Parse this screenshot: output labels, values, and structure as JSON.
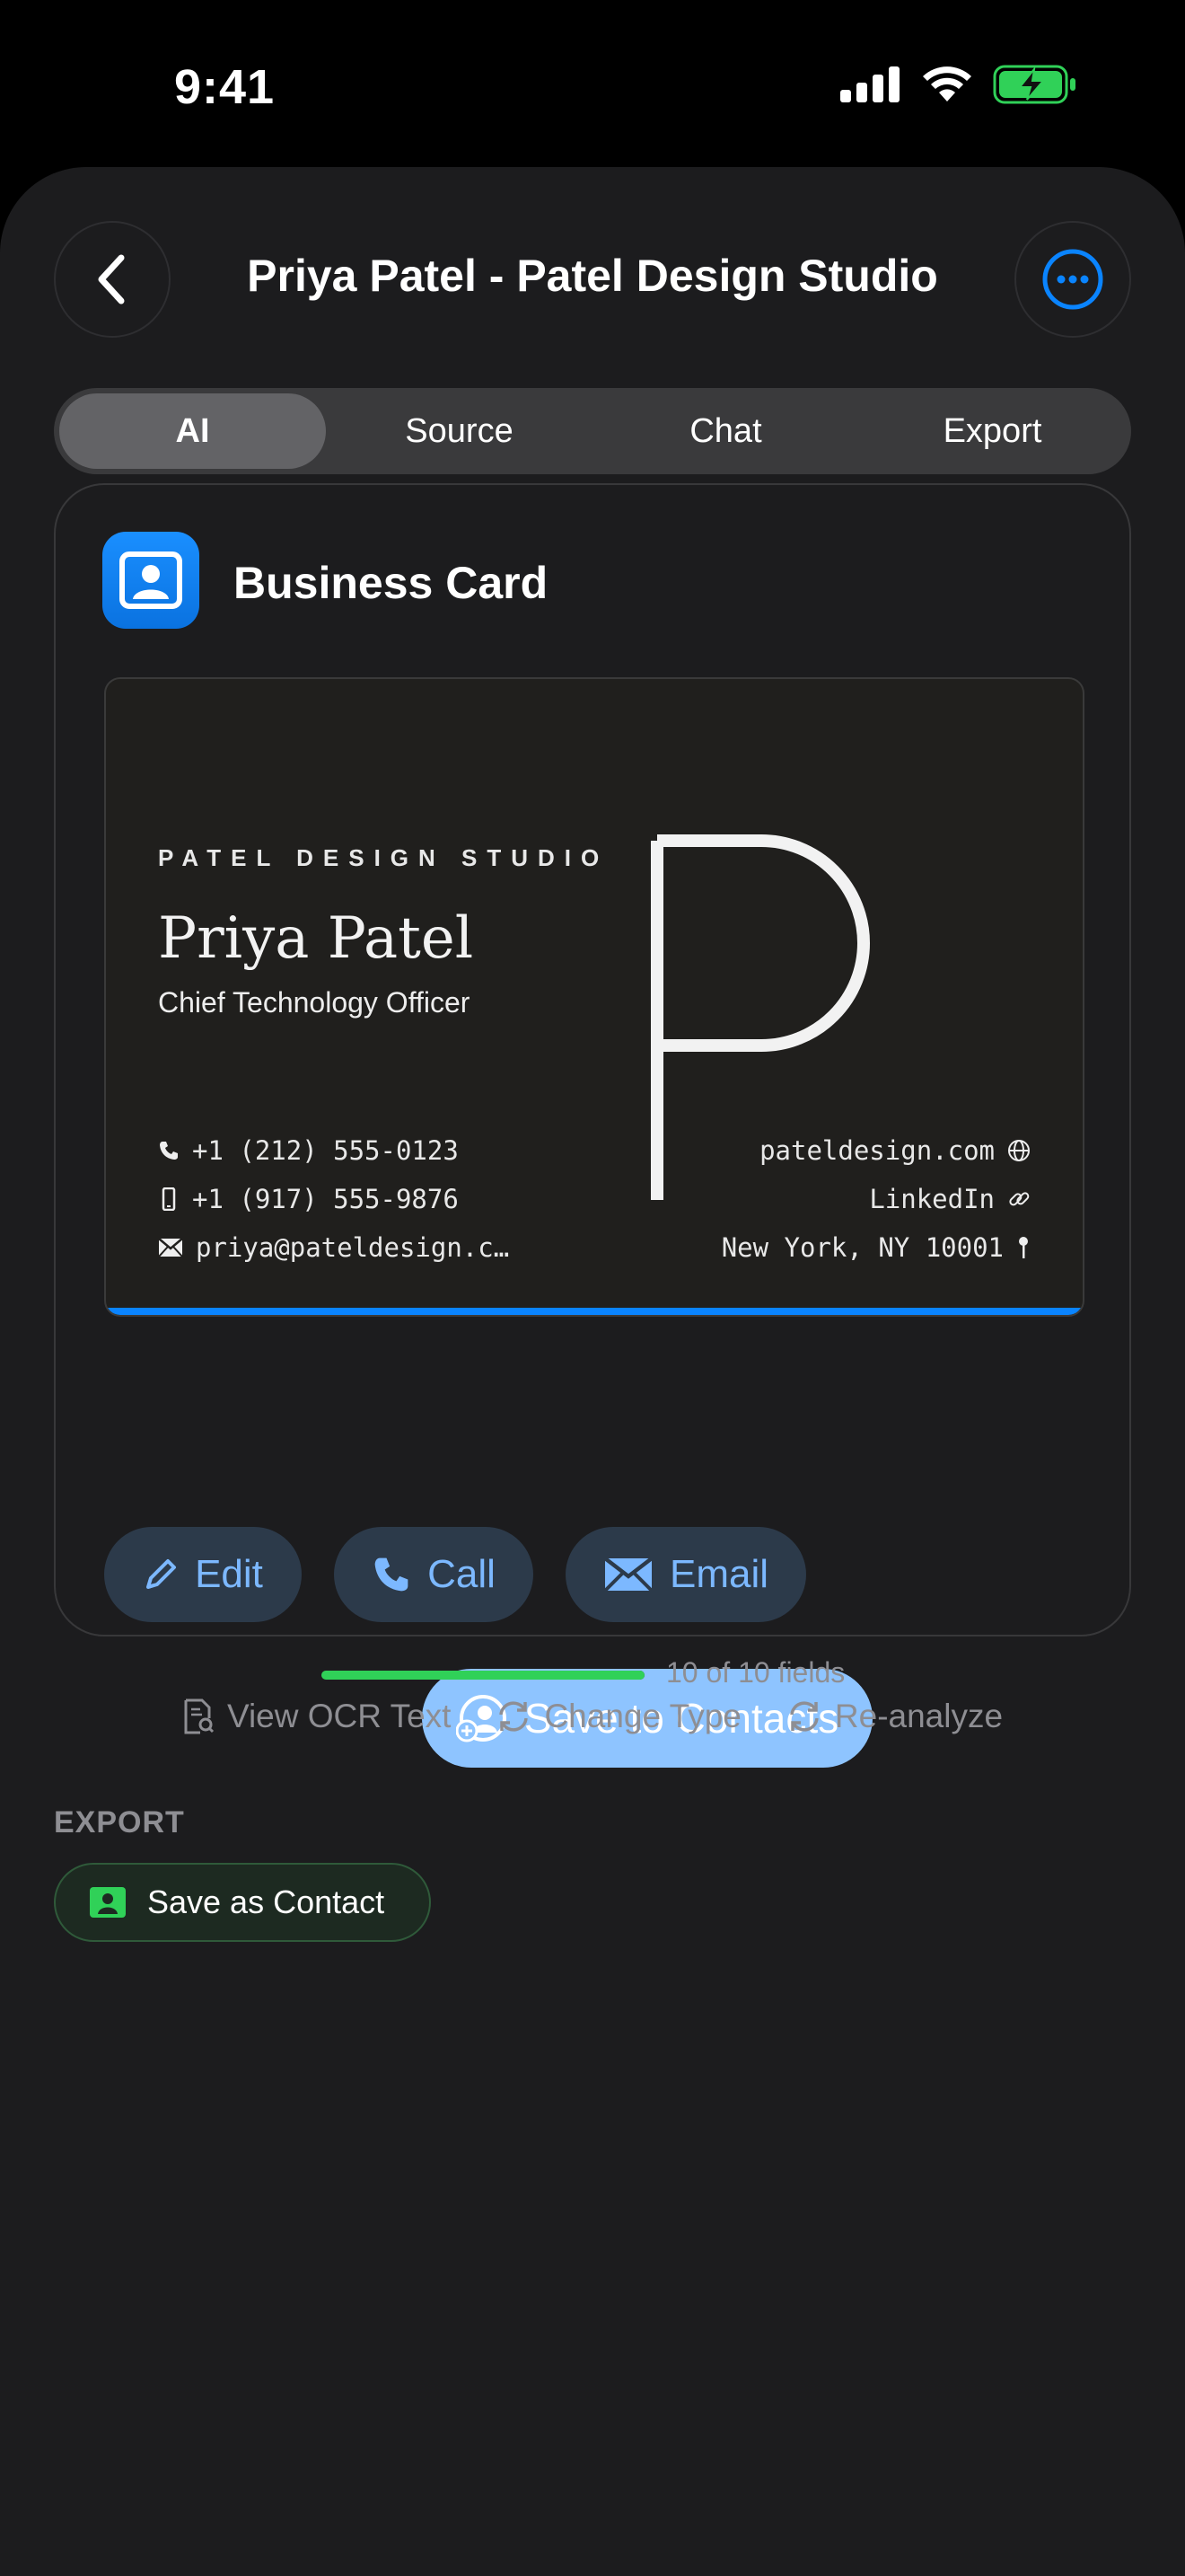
{
  "status_bar": {
    "time": "9:41"
  },
  "nav": {
    "title": "Priya Patel - Patel Design Studio"
  },
  "tabs": [
    {
      "label": "AI",
      "active": true
    },
    {
      "label": "Source",
      "active": false
    },
    {
      "label": "Chat",
      "active": false
    },
    {
      "label": "Export",
      "active": false
    }
  ],
  "card_type": {
    "label": "Business Card"
  },
  "business_card": {
    "company": "PATEL DESIGN STUDIO",
    "name": "Priya Patel",
    "title": "Chief Technology Officer",
    "phone": "+1 (212) 555-0123",
    "mobile": "+1 (917) 555-9876",
    "email": "priya@pateldesign.c…",
    "website": "pateldesign.com",
    "linkedin": "LinkedIn",
    "address": "New York, NY 10001",
    "monogram": "P"
  },
  "actions": {
    "edit": "Edit",
    "call": "Call",
    "email": "Email",
    "save_contacts": "Save to Contacts"
  },
  "progress": {
    "text": "10 of 10 fields",
    "filled": 10,
    "total": 10
  },
  "tools": {
    "ocr": "View OCR Text",
    "change_type": "Change Type",
    "reanalyze": "Re-analyze"
  },
  "export": {
    "section_label": "EXPORT",
    "save_as_contact": "Save as Contact"
  },
  "colors": {
    "accent": "#0a84ff",
    "success": "#30d158",
    "pill_text": "#7cb8ff"
  }
}
